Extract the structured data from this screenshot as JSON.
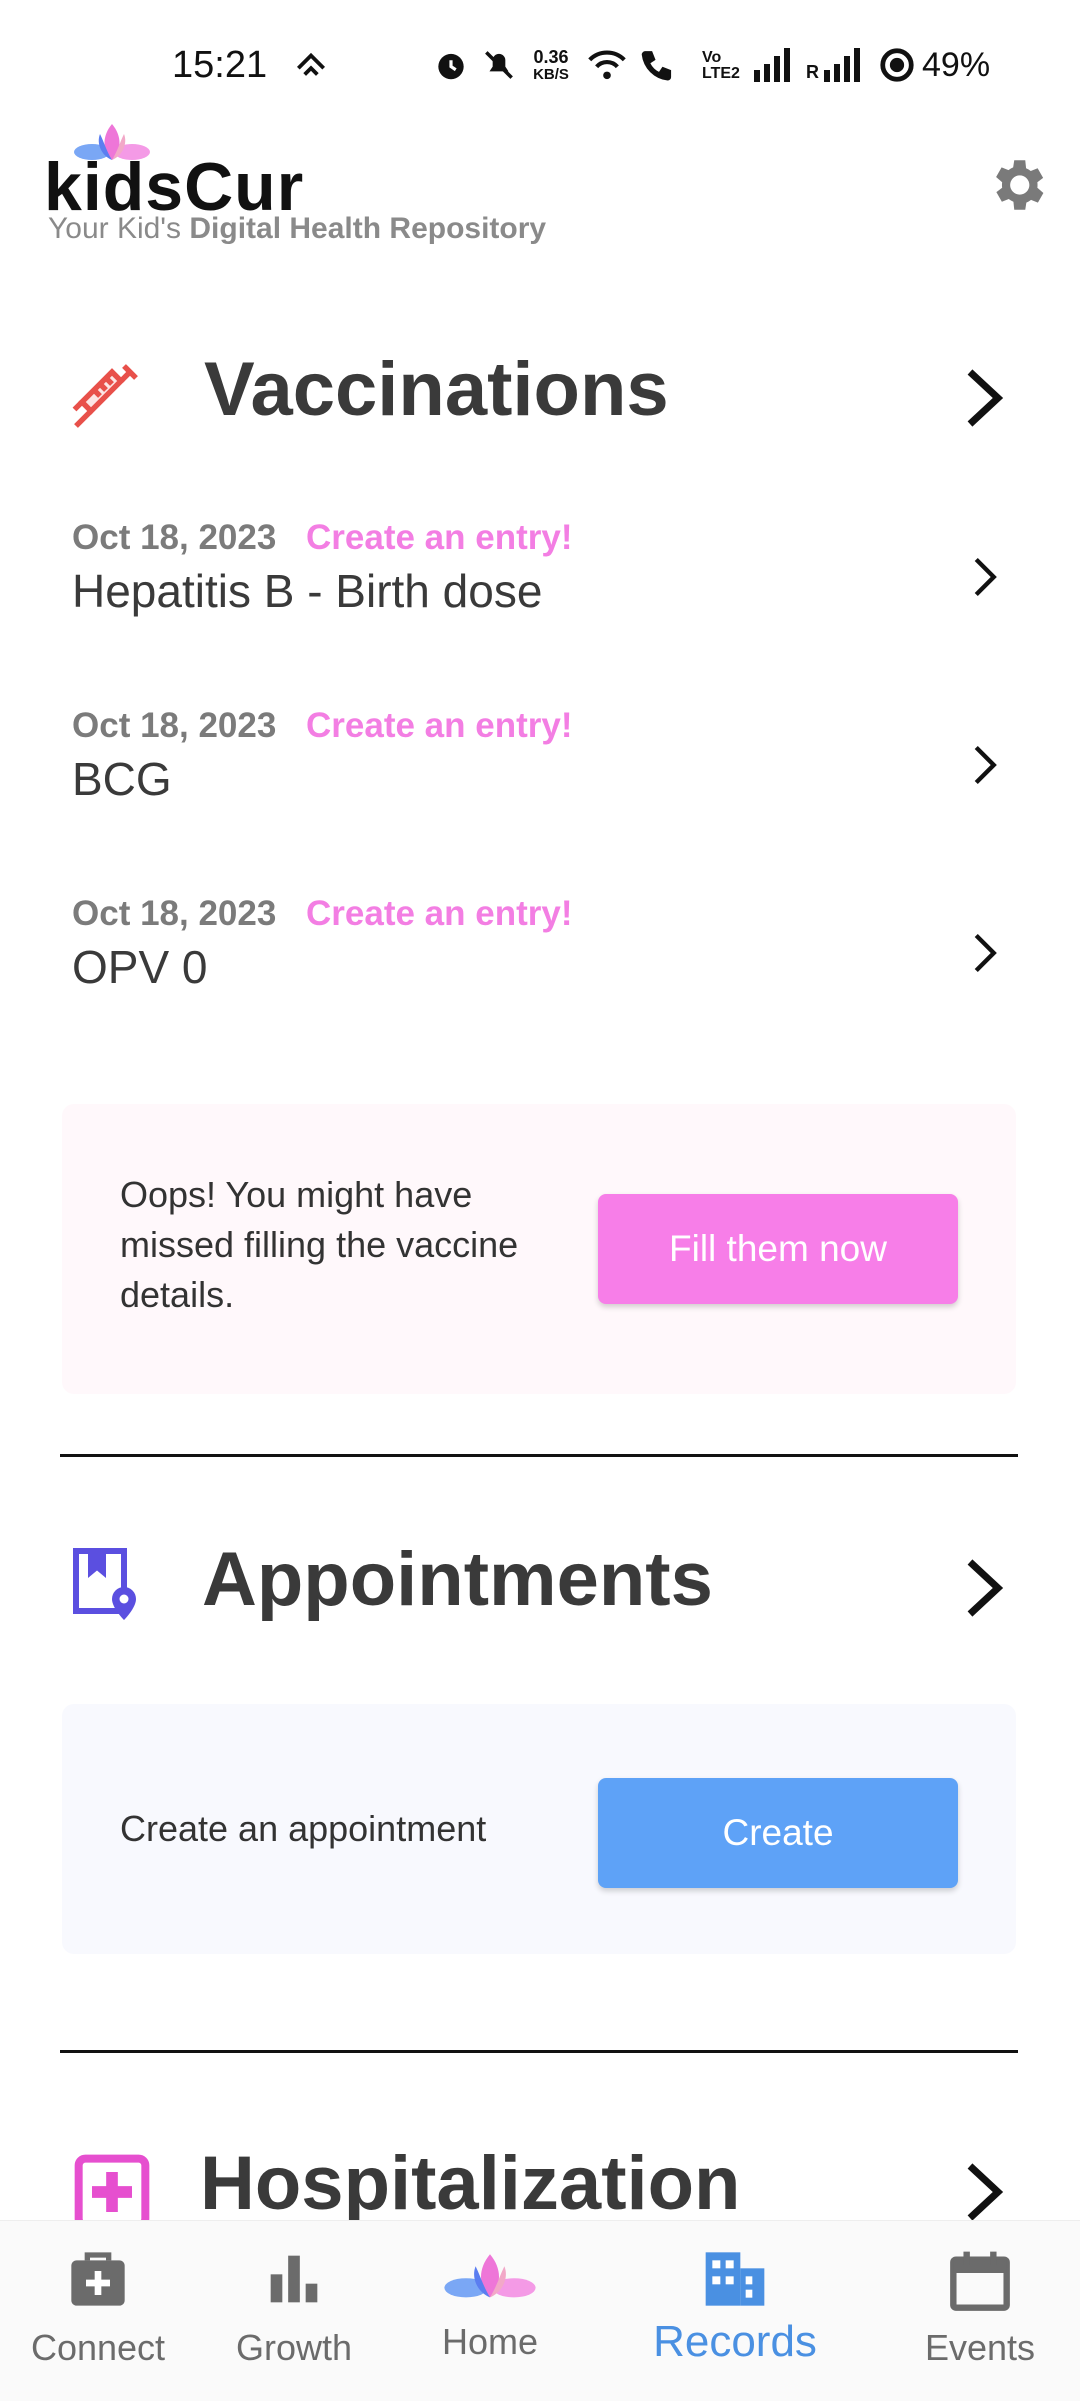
{
  "status_bar": {
    "time": "15:21",
    "net_speed_value": "0.36",
    "net_speed_unit": "KB/S",
    "volte_top": "Vo",
    "volte_bottom": "LTE2",
    "roaming": "R",
    "battery": "49%"
  },
  "header": {
    "logo_text": "kidsCur",
    "tagline_prefix": "Your Kid's ",
    "tagline_bold": "Digital Health Repository",
    "settings_icon": "gear-icon"
  },
  "vaccinations": {
    "title": "Vaccinations",
    "icon": "syringe-icon",
    "items": [
      {
        "date": "Oct 18, 2023",
        "action": "Create an entry!",
        "name": "Hepatitis B - Birth dose"
      },
      {
        "date": "Oct 18, 2023",
        "action": "Create an entry!",
        "name": "BCG"
      },
      {
        "date": "Oct 18, 2023",
        "action": "Create an entry!",
        "name": "OPV 0"
      }
    ],
    "card": {
      "message": "Oops! You might have missed filling the vaccine details.",
      "button_label": "Fill them now",
      "button_color": "#f77ee8",
      "background": "#fff8fb"
    }
  },
  "appointments": {
    "title": "Appointments",
    "icon": "bookmark-location-icon",
    "card": {
      "message": "Create an appointment",
      "button_label": "Create",
      "button_color": "#5ea2f7",
      "background": "#f8f9fe"
    }
  },
  "hospitalization": {
    "title": "Hospitalization",
    "icon": "medical-plus-icon"
  },
  "bottom_nav": {
    "items": [
      {
        "label": "Connect",
        "icon": "medical-bag-icon",
        "active": false
      },
      {
        "label": "Growth",
        "icon": "bar-chart-icon",
        "active": false
      },
      {
        "label": "Home",
        "icon": "lotus-icon",
        "active": false
      },
      {
        "label": "Records",
        "icon": "building-icon",
        "active": true
      },
      {
        "label": "Events",
        "icon": "calendar-icon",
        "active": false
      }
    ],
    "active_color": "#4a90e2"
  },
  "colors": {
    "accent_pink": "#f37ee3",
    "accent_blue": "#5ea2f7",
    "syringe_red": "#e8504a",
    "appointment_purple": "#5b4fe0"
  }
}
